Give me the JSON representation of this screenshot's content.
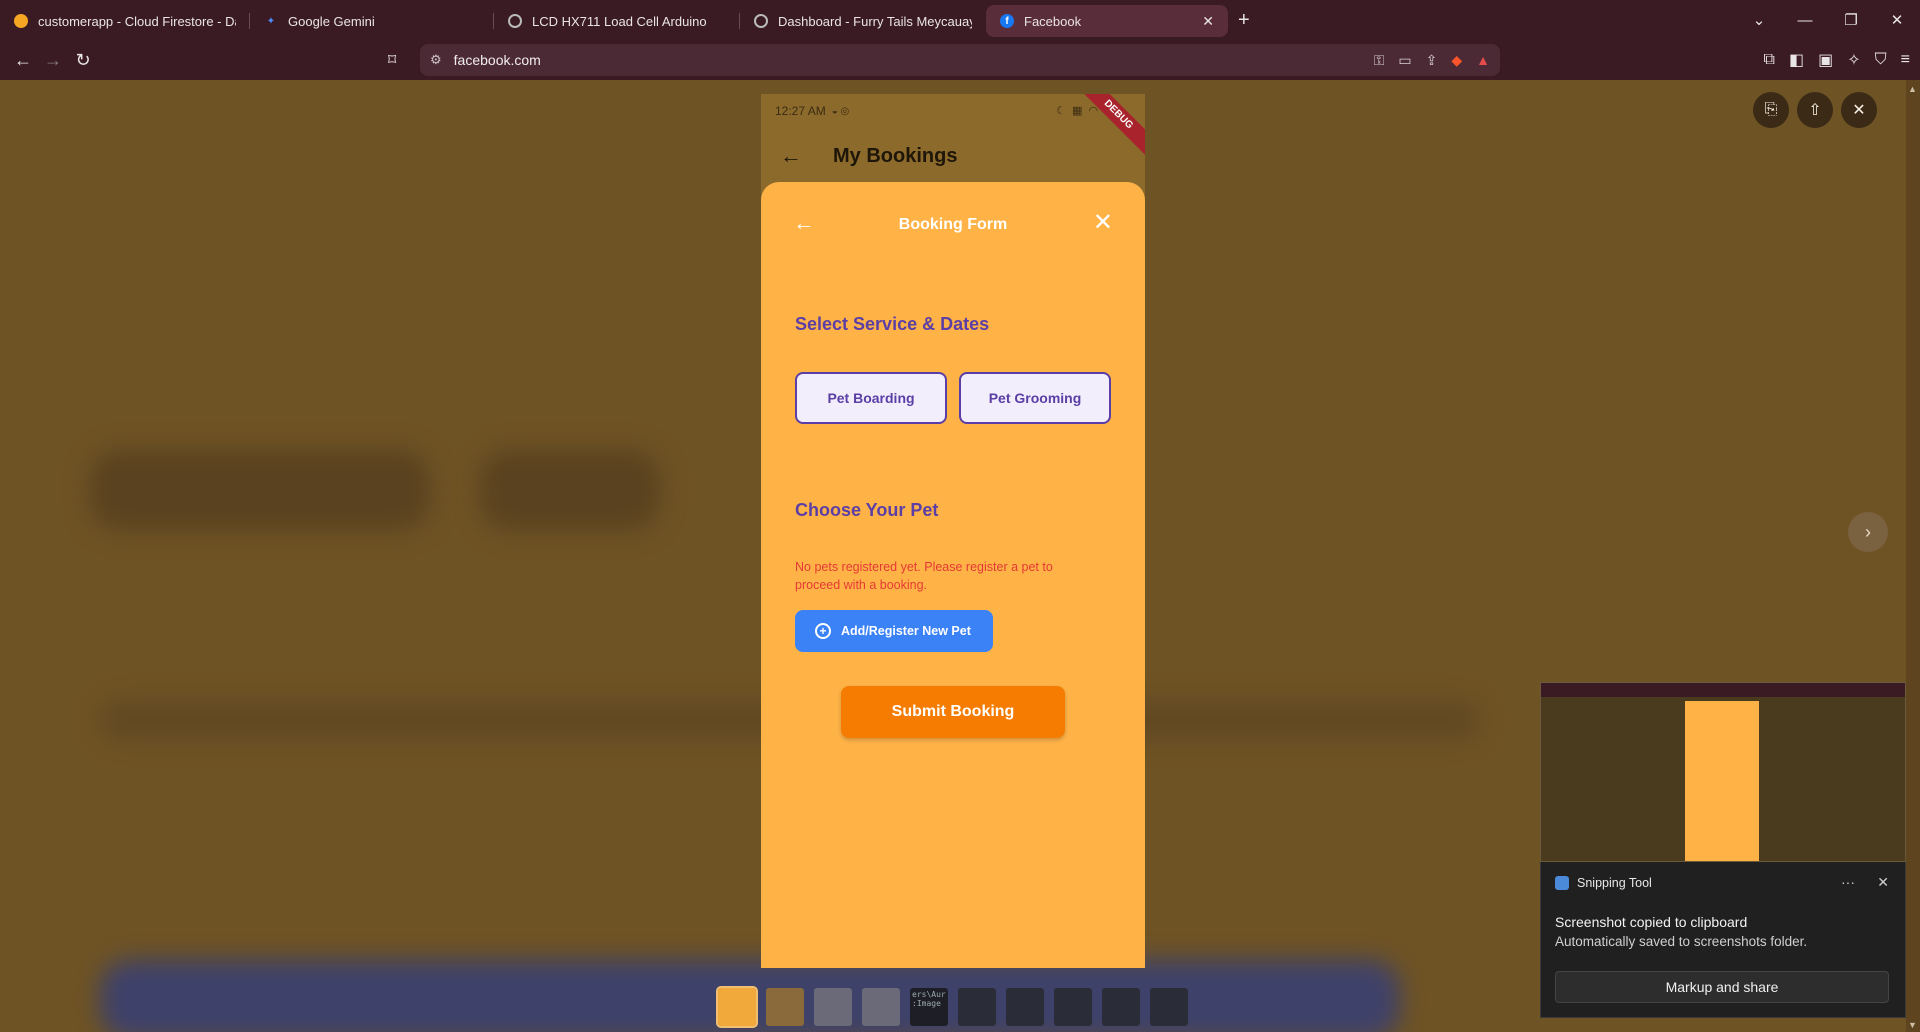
{
  "browser": {
    "tabs": [
      {
        "label": "customerapp - Cloud Firestore - Data",
        "favicon_color": "#f5a623"
      },
      {
        "label": "Google Gemini",
        "favicon_color": "#4e8cff"
      },
      {
        "label": "LCD HX711 Load Cell Arduino",
        "favicon_color": "#9a9a9a"
      },
      {
        "label": "Dashboard - Furry Tails Meycauayan",
        "favicon_color": "#9a9a9a"
      },
      {
        "label": "Facebook",
        "favicon_color": "#1877f2"
      }
    ],
    "active_tab": 4,
    "address": "facebook.com"
  },
  "phone": {
    "status_time": "12:27 AM",
    "debug_ribbon": "DEBUG",
    "appbar_title": "My Bookings",
    "sheet": {
      "title": "Booking Form",
      "service_section_title": "Select Service & Dates",
      "services": [
        "Pet Boarding",
        "Pet Grooming"
      ],
      "pet_section_title": "Choose Your Pet",
      "no_pets_message": "No pets registered yet. Please register a pet to proceed with a booking.",
      "add_pet_label": "Add/Register New Pet",
      "submit_label": "Submit Booking"
    }
  },
  "snip": {
    "app_name": "Snipping Tool",
    "title": "Screenshot copied to clipboard",
    "subtitle": "Automatically saved to screenshots folder.",
    "button": "Markup and share"
  },
  "filmstrip": {
    "terminal_text": "ers\\Aur\n:Image"
  },
  "colors": {
    "sheet_bg": "#ffb347",
    "accent_purple": "#5b3ea6",
    "error_red": "#e53935",
    "add_blue": "#3b82f6",
    "submit_orange": "#f57c00"
  }
}
